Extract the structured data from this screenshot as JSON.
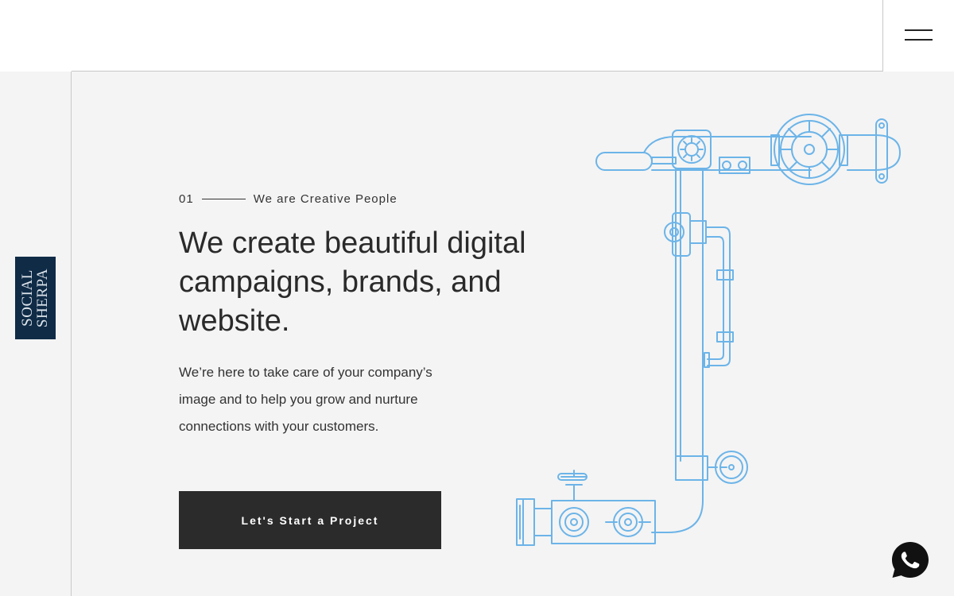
{
  "header": {
    "menu_icon": "hamburger-icon"
  },
  "logo": {
    "line1": "SOCIAL",
    "line2": "SHERPA",
    "background": "#0f2b46"
  },
  "hero": {
    "index": "01",
    "eyebrow": "We are Creative People",
    "headline": "We create beautiful digital campaigns, brands, and website.",
    "description": "We’re here to take care of your company’s image and to help you grow and nurture connections with your customers.",
    "cta_label": "Let's Start a Project",
    "illustration_icon": "pipeline-illustration-icon",
    "accent": "#6cb4e8"
  },
  "floating": {
    "whatsapp_icon": "whatsapp-icon"
  }
}
